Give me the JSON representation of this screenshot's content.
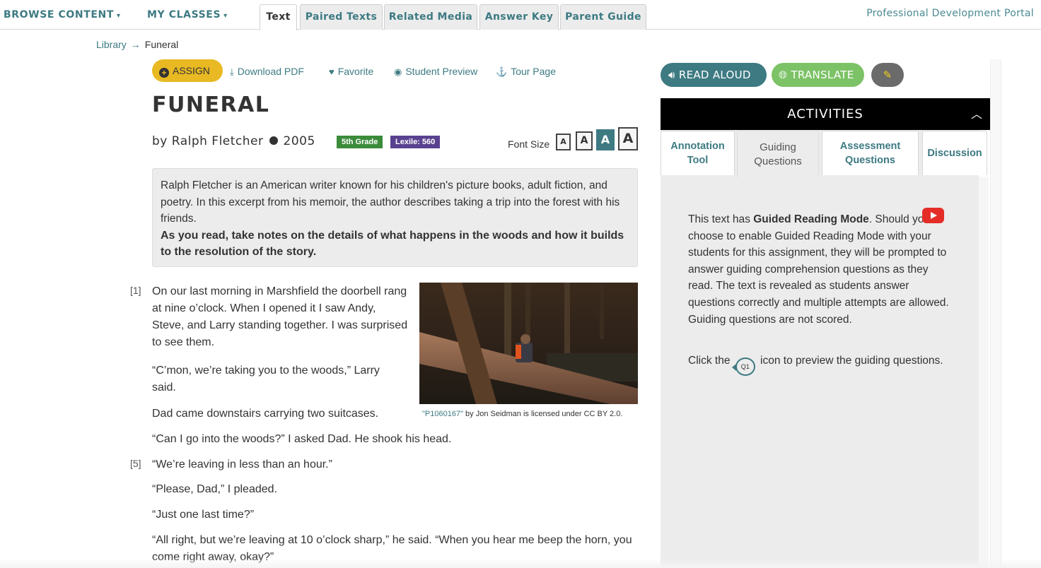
{
  "nav": {
    "menus": [
      {
        "label": "BROWSE CONTENT",
        "caret": "▾"
      },
      {
        "label": "MY CLASSES",
        "caret": "▾"
      }
    ],
    "tabs": [
      {
        "label": "Text",
        "active": true
      },
      {
        "label": "Paired Texts",
        "active": false
      },
      {
        "label": "Related Media",
        "active": false
      },
      {
        "label": "Answer Key",
        "active": false
      },
      {
        "label": "Parent Guide",
        "active": false
      }
    ],
    "portal_link": "Professional Development Portal"
  },
  "breadcrumb": {
    "root": "Library",
    "arrow": "→",
    "current": "Funeral"
  },
  "actions": {
    "assign": "ASSIGN",
    "download": "Download PDF",
    "favorite": "Favorite",
    "student_preview": "Student Preview",
    "tour": "Tour Page"
  },
  "text": {
    "title": "FUNERAL",
    "author": "by Ralph Fletcher",
    "year": "2005",
    "grade_badge": "5th Grade",
    "lexile_badge": "Lexile: 560",
    "font_size_label": "Font Size",
    "font_size_options": [
      "A",
      "A",
      "A",
      "A"
    ],
    "font_size_selected_index": 2,
    "intro": "Ralph Fletcher is an American writer known for his children's picture books, adult fiction, and poetry. In this excerpt from his memoir, the author describes taking a trip into the forest with his friends.",
    "intro_prompt": "As you read, take notes on the details of what happens in the woods and how it builds to the resolution of the story.",
    "paragraph_numbers": [
      "[1]",
      "[5]"
    ],
    "paragraphs": [
      "On our last morning in Marshfield the doorbell rang at nine o’clock. When I opened it I saw Andy, Steve, and Larry standing together. I was surprised to see them.",
      "“C’mon, we’re taking you to the woods,” Larry said.",
      "Dad came downstairs carrying two suitcases.",
      "“Can I go into the woods?” I asked Dad. He shook his head.",
      "“We’re leaving in less than an hour.”",
      "“Please, Dad,” I pleaded.",
      "“Just one last time?”",
      "“All right, but we’re leaving at 10 o’clock sharp,” he said. “When you hear me beep the horn, you come right away, okay?”"
    ],
    "image_caption": {
      "link": "\"P1060167\"",
      "rest": " by Jon Seidman is licensed under CC BY 2.0."
    }
  },
  "panel": {
    "read_aloud": "READ ALOUD",
    "translate": "TRANSLATE",
    "activities_title": "ACTIVITIES",
    "tabs": [
      {
        "label": "Annotation Tool",
        "active": false
      },
      {
        "label": "Guiding Questions",
        "active": true
      },
      {
        "label": "Assessment Questions",
        "active": false
      },
      {
        "label": "Discussion",
        "active": false
      }
    ],
    "guided": {
      "pre": "This text has ",
      "bold": "Guided Reading Mode",
      "post": ". Should you choose to enable Guided Reading Mode with your students for this assignment, they will be prompted to answer guiding comprehension questions as they read. The text is revealed as students answer questions correctly and multiple attempts are allowed. Guiding questions are not scored.",
      "click_pre": "Click the ",
      "q1_icon_label": "Q1",
      "click_post": " icon to preview the guiding questions."
    }
  },
  "colors": {
    "teal": "#3d7a82",
    "assign_yellow": "#e8b923",
    "translate_green": "#7cc266",
    "grade_green": "#3b8b3b",
    "lexile_purple": "#5a4190",
    "youtube_red": "#e52d27"
  }
}
